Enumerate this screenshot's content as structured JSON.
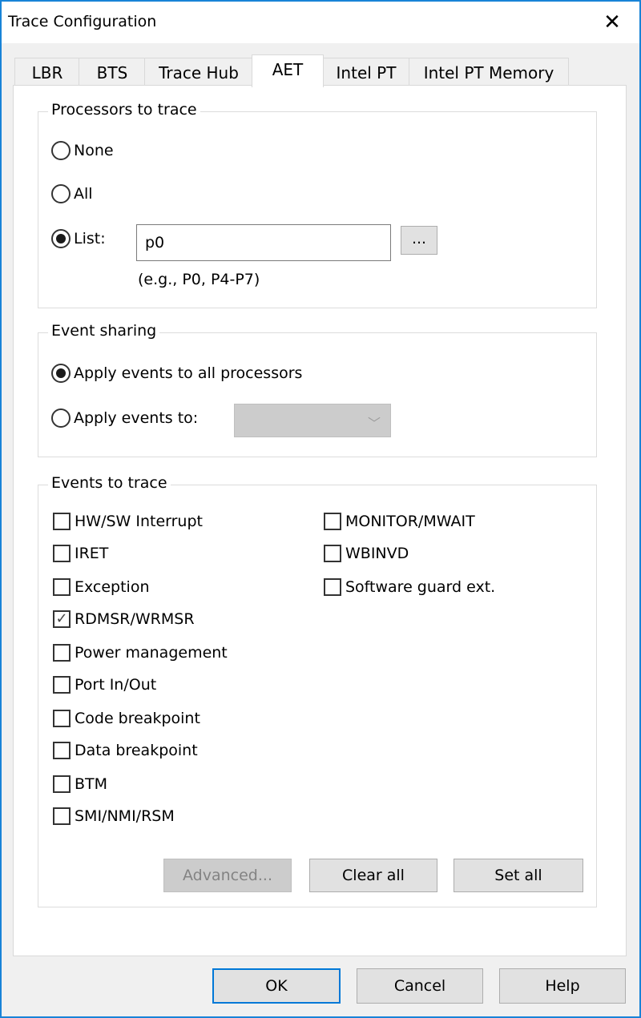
{
  "window": {
    "title": "Trace Configuration",
    "close_icon": "close-icon"
  },
  "tabs": [
    {
      "label": "LBR",
      "active": false
    },
    {
      "label": "BTS",
      "active": false
    },
    {
      "label": "Trace Hub",
      "active": false
    },
    {
      "label": "AET",
      "active": true
    },
    {
      "label": "Intel PT",
      "active": false
    },
    {
      "label": "Intel PT Memory",
      "active": false
    }
  ],
  "processors": {
    "legend": "Processors to trace",
    "options": [
      {
        "label": "None",
        "selected": false
      },
      {
        "label": "All",
        "selected": false
      },
      {
        "label": "List:",
        "selected": true
      }
    ],
    "list_value": "p0",
    "browse_label": "...",
    "hint": "(e.g., P0, P4-P7)"
  },
  "event_sharing": {
    "legend": "Event sharing",
    "options": [
      {
        "label": "Apply events to all processors",
        "selected": true
      },
      {
        "label": "Apply events to:",
        "selected": false
      }
    ],
    "combo_value": ""
  },
  "events": {
    "legend": "Events to trace",
    "left": [
      {
        "label": "HW/SW Interrupt",
        "checked": false
      },
      {
        "label": "IRET",
        "checked": false
      },
      {
        "label": "Exception",
        "checked": false
      },
      {
        "label": "RDMSR/WRMSR",
        "checked": true
      },
      {
        "label": "Power management",
        "checked": false
      },
      {
        "label": "Port In/Out",
        "checked": false
      },
      {
        "label": "Code breakpoint",
        "checked": false
      },
      {
        "label": "Data breakpoint",
        "checked": false
      },
      {
        "label": "BTM",
        "checked": false
      },
      {
        "label": "SMI/NMI/RSM",
        "checked": false
      }
    ],
    "right": [
      {
        "label": "MONITOR/MWAIT",
        "checked": false
      },
      {
        "label": "WBINVD",
        "checked": false
      },
      {
        "label": "Software guard ext.",
        "checked": false
      }
    ],
    "buttons": {
      "advanced": "Advanced...",
      "clear_all": "Clear all",
      "set_all": "Set all"
    }
  },
  "footer": {
    "ok": "OK",
    "cancel": "Cancel",
    "help": "Help"
  },
  "colors": {
    "accent": "#0078d7",
    "window_border": "#1883d7"
  }
}
